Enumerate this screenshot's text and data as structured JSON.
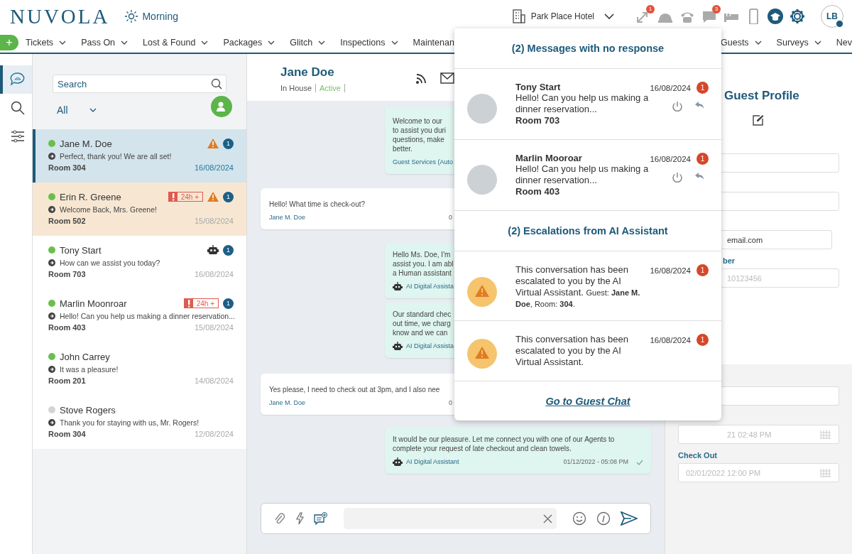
{
  "app": {
    "logo": "NUVOLA",
    "greeting": "Morning"
  },
  "hotel": {
    "name": "Park Place Hotel"
  },
  "toolbar": [
    {
      "kind": "transfer",
      "badge": "1"
    },
    {
      "kind": "bell"
    },
    {
      "kind": "phone"
    },
    {
      "kind": "chat",
      "badge": "3"
    },
    {
      "kind": "bed"
    },
    {
      "kind": "mobile"
    },
    {
      "kind": "academy"
    },
    {
      "kind": "settings"
    }
  ],
  "user": {
    "initials": "LB"
  },
  "nav": {
    "add_label": "+",
    "items": [
      {
        "label": "Tickets",
        "dropdown": true
      },
      {
        "label": "Pass On",
        "dropdown": true
      },
      {
        "label": "Lost & Found",
        "dropdown": true
      },
      {
        "label": "Packages",
        "dropdown": true
      },
      {
        "label": "Glitch",
        "dropdown": true
      },
      {
        "label": "Inspections",
        "dropdown": true
      },
      {
        "label": "Maintenan",
        "dropdown": false
      }
    ],
    "items_right": [
      {
        "label": "Guests",
        "dropdown": true
      },
      {
        "label": "Surveys",
        "dropdown": true
      },
      {
        "label": "Nev",
        "dropdown": false
      }
    ]
  },
  "rail": [
    {
      "kind": "chat",
      "selected": true
    },
    {
      "kind": "search",
      "selected": false
    },
    {
      "kind": "filters",
      "selected": false
    }
  ],
  "conversation_list": {
    "search": {
      "placeholder": "Search"
    },
    "filter": "All",
    "conversations": [
      {
        "name": "Jane M. Doe",
        "online": true,
        "preview": "Perfect, thank you! We are all set!",
        "room": "Room 304",
        "date": "16/08/2024",
        "selected": true,
        "highlighted": false,
        "warning": true,
        "bot": false,
        "unread": "1"
      },
      {
        "name": "Erin R. Greene",
        "online": true,
        "preview": "Welcome Back, Mrs. Greene!",
        "room": "Room 502",
        "date": "15/08/2024",
        "selected": false,
        "highlighted": true,
        "overdue": "24h +",
        "warning": true,
        "bot": false,
        "unread": "1"
      },
      {
        "name": "Tony Start",
        "online": true,
        "preview": "How can we assist you today?",
        "room": "Room 703",
        "date": "16/08/2024",
        "selected": false,
        "highlighted": false,
        "warning": false,
        "bot": true,
        "unread": "1"
      },
      {
        "name": "Marlin Moonroar",
        "online": true,
        "preview": "Hello! Can you help us making a dinner reservation...",
        "room": "Room 403",
        "date": "15/08/2024",
        "selected": false,
        "highlighted": false,
        "overdue": "24h +",
        "warning": false,
        "bot": false,
        "unread": "1"
      },
      {
        "name": "John Carrey",
        "online": true,
        "preview": "It was a pleasure!",
        "room": "Room 201",
        "date": "14/08/2024",
        "selected": false,
        "highlighted": false,
        "warning": false,
        "bot": false
      },
      {
        "name": "Stove Rogers",
        "online": false,
        "preview": "Thank you for staying with us, Mr. Rogers!",
        "room": "Room 304",
        "date": "12/08/2024",
        "selected": false,
        "highlighted": false,
        "warning": false,
        "bot": false
      }
    ]
  },
  "chat": {
    "name": "Jane Doe",
    "stay": "In House",
    "status": "Active",
    "messages": [
      {
        "kind": "bot",
        "text": "Welcome to our\nto assist you duri\nquestions, make\nbetter.",
        "sender": "Guest Services (Auto"
      },
      {
        "kind": "guest",
        "text": "Hello! What time is check-out?",
        "sender": "Jane M. Doe",
        "time": "0"
      },
      {
        "kind": "bot",
        "text": "Hello Ms. Doe, I'm\nassist you. I am abl\na Human assistant",
        "sender": "AI Digital Assista"
      },
      {
        "kind": "bot",
        "text": "Our standard chec\nout time, we charg\nknow and we can",
        "sender": "AI Digital Assista"
      },
      {
        "kind": "guest",
        "text": "Yes please, I need to check out at 3pm, and I also nee",
        "sender": "Jane M. Doe",
        "time": "0"
      },
      {
        "kind": "bot",
        "text": "It would be our pleasure. Let me connect you with one of our Agents to\ncomplete your request of late checkout and clean towels.",
        "sender": "AI Digital Assistant",
        "time": "01/12/2022 - 05:08 PM",
        "read": true
      }
    ]
  },
  "profile": {
    "title": "Guest Profile",
    "sections": [
      {
        "kind": "contact",
        "fields": [
          {
            "kind": "text"
          },
          {
            "kind": "text"
          },
          {
            "kind": "text",
            "value": "email.com"
          },
          {
            "kind": "text",
            "label": "ber",
            "placeholder": "10123456"
          }
        ]
      },
      {
        "kind": "stay",
        "fields": [
          {
            "kind": "text"
          },
          {
            "kind": "date",
            "placeholder": "21 02:48 PM"
          },
          {
            "kind": "date",
            "label": "Check Out",
            "placeholder": "02/01/2022 12:00 PM"
          }
        ]
      }
    ]
  },
  "popup": {
    "title": "(2) Messages with no response",
    "messages": [
      {
        "name": "Tony Start",
        "text": "Hello! Can you help us making a dinner reservation...",
        "room": "Room 703",
        "date": "16/08/2024",
        "count": "1"
      },
      {
        "name": "Marlin Mooroar",
        "text": "Hello! Can you help us making a dinner reservation...",
        "room": "Room 403",
        "date": "16/08/2024",
        "count": "1"
      }
    ],
    "escalations_title": "(2) Escalations from AI Assistant",
    "escalations": [
      {
        "text": "This conversation has been escalated to you by the AI Virtual Assistant.",
        "detail": "Guest: **Jane M. Doe**, Room: **304**.",
        "date": "16/08/2024",
        "count": "1"
      },
      {
        "text": "This conversation has been escalated to you by the AI Virtual Assistant.",
        "date": "16/08/2024",
        "count": "1"
      }
    ],
    "link": "Go to Guest Chat"
  }
}
